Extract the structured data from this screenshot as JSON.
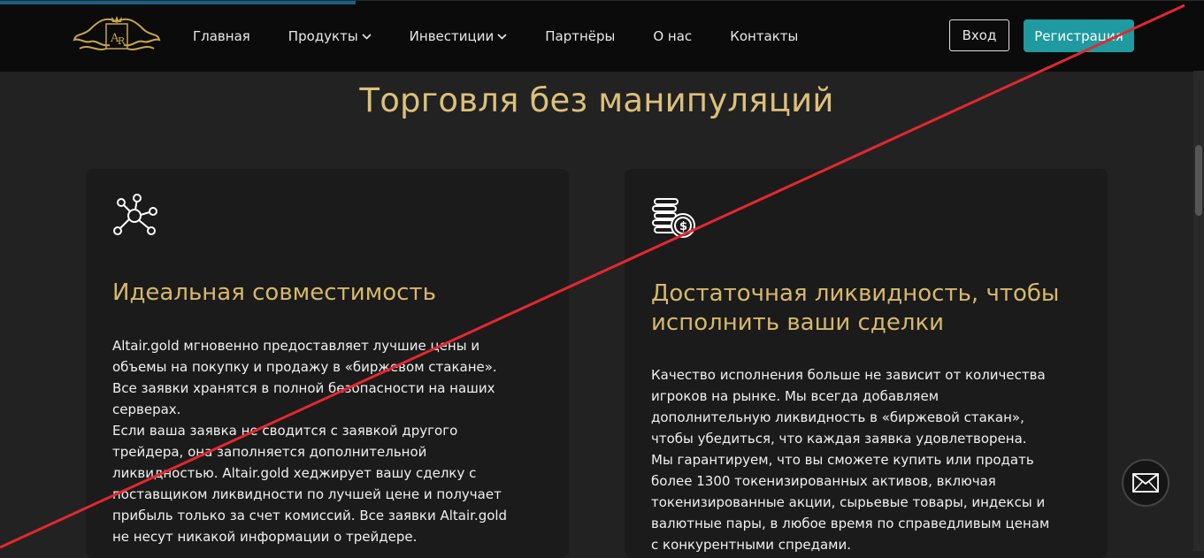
{
  "header": {
    "nav": [
      {
        "label": "Главная",
        "dropdown": false
      },
      {
        "label": "Продукты",
        "dropdown": true
      },
      {
        "label": "Инвестиции",
        "dropdown": true
      },
      {
        "label": "Партнёры",
        "dropdown": false
      },
      {
        "label": "О нас",
        "dropdown": false
      },
      {
        "label": "Контакты",
        "dropdown": false
      }
    ],
    "login_label": "Вход",
    "register_label": "Регистрация"
  },
  "page_title": "Торговля без манипуляций",
  "cards": [
    {
      "icon": "network-nodes-icon",
      "title": "Идеальная совместимость",
      "paragraphs": [
        "Altair.gold мгновенно предоставляет лучшие цены и объемы на покупку и продажу в «биржевом стакане». Все заявки хранятся в полной безопасности на наших серверах.",
        "Если ваша заявка не сводится с заявкой другого трейдера, она заполняется дополнительной ликвидностью. Altair.gold хеджирует вашу сделку с поставщиком ликвидности по лучшей цене и получает прибыль только за счет комиссий. Все заявки Altair.gold не несут никакой информации о трейдере."
      ]
    },
    {
      "icon": "coins-dollar-icon",
      "title": "Достаточная ликвидность, чтобы исполнить ваши сделки",
      "paragraphs": [
        "Качество исполнения больше не зависит от количества игроков на рынке. Мы всегда добавляем дополнительную ликвидность в «биржевой стакан», чтобы убедиться, что каждая заявка удовлетворена.",
        "Мы гарантируем, что вы сможете купить или продать более 1300 токенизированных активов, включая токенизированные акции, сырьевые товары, индексы и валютные пары, в любое время по справедливым ценам с конкурентными спредами."
      ]
    }
  ],
  "colors": {
    "accent_gold": "#dcc07a",
    "register_teal": "#1e9aa0",
    "overlay_red": "#e3282f"
  }
}
